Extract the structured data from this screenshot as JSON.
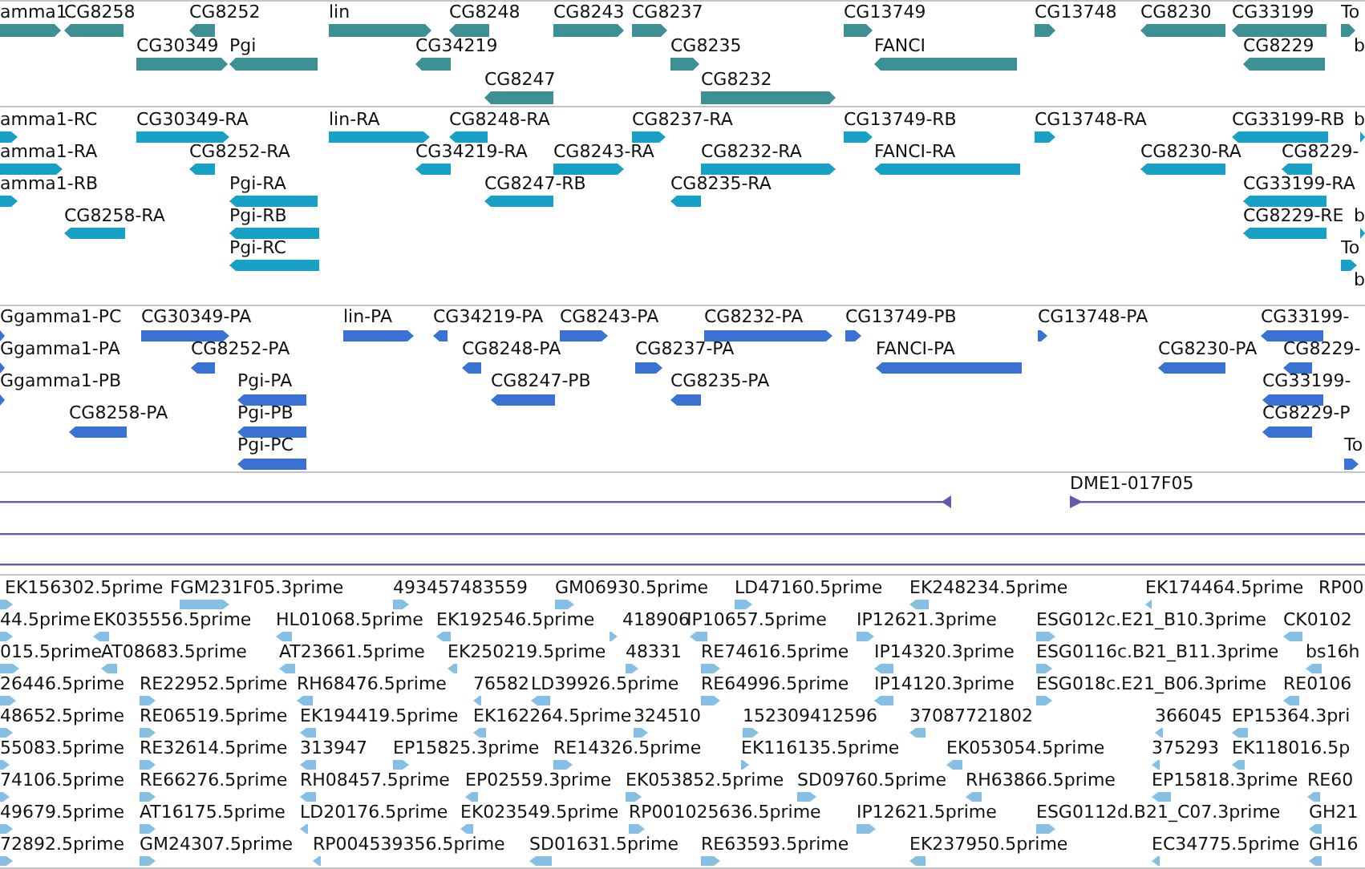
{
  "tracks": [
    {
      "kind": "gene",
      "rows": [
        {
          "features": [
            {
              "label": "amma1",
              "reverse": false
            },
            {
              "label": "CG8258",
              "reverse": true
            },
            {
              "label": "CG8252",
              "reverse": true
            },
            {
              "label": "lin",
              "reverse": false
            },
            {
              "label": "CG8248",
              "reverse": true
            },
            {
              "label": "CG8243",
              "reverse": false
            },
            {
              "label": "CG8237",
              "reverse": false
            },
            {
              "label": "CG13749",
              "reverse": false
            },
            {
              "label": "CG13748",
              "reverse": false
            },
            {
              "label": "CG8230",
              "reverse": true
            },
            {
              "label": "CG33199",
              "reverse": true
            },
            {
              "label": "To",
              "reverse": false
            }
          ]
        },
        {
          "features": [
            {
              "label": "CG30349",
              "reverse": false
            },
            {
              "label": "Pgi",
              "reverse": true
            },
            {
              "label": "CG34219",
              "reverse": true
            },
            {
              "label": "CG8235",
              "reverse": false
            },
            {
              "label": "FANCI",
              "reverse": true
            },
            {
              "label": "CG8229",
              "reverse": true
            },
            {
              "label": "b"
            }
          ]
        },
        {
          "features": [
            {
              "label": "CG8247",
              "reverse": true
            },
            {
              "label": "CG8232",
              "reverse": false
            }
          ]
        }
      ]
    },
    {
      "kind": "mrna",
      "rows": [
        {
          "features": [
            {
              "label": "amma1-RC",
              "reverse": false
            },
            {
              "label": "CG30349-RA",
              "reverse": false
            },
            {
              "label": "lin-RA",
              "reverse": false
            },
            {
              "label": "CG8248-RA",
              "reverse": true
            },
            {
              "label": "CG8237-RA",
              "reverse": false
            },
            {
              "label": "CG13749-RB",
              "reverse": false
            },
            {
              "label": "CG13748-RA",
              "reverse": false
            },
            {
              "label": "CG33199-RB",
              "reverse": true
            },
            {
              "label": "b",
              "reverse": false
            }
          ]
        },
        {
          "features": [
            {
              "label": "amma1-RA",
              "reverse": false
            },
            {
              "label": "CG8252-RA",
              "reverse": true
            },
            {
              "label": "CG34219-RA",
              "reverse": true
            },
            {
              "label": "CG8243-RA",
              "reverse": false
            },
            {
              "label": "CG8232-RA",
              "reverse": false
            },
            {
              "label": "FANCI-RA",
              "reverse": true
            },
            {
              "label": "CG8230-RA",
              "reverse": true
            },
            {
              "label": "CG8229-",
              "reverse": true
            }
          ]
        },
        {
          "features": [
            {
              "label": "amma1-RB",
              "reverse": false
            },
            {
              "label": "Pgi-RA",
              "reverse": true
            },
            {
              "label": "CG8247-RB",
              "reverse": true
            },
            {
              "label": "CG8235-RA",
              "reverse": true
            },
            {
              "label": "CG33199-RA",
              "reverse": true
            }
          ]
        },
        {
          "features": [
            {
              "label": "CG8258-RA",
              "reverse": true
            },
            {
              "label": "Pgi-RB",
              "reverse": true
            },
            {
              "label": "CG8229-RE",
              "reverse": true
            },
            {
              "label": "b",
              "reverse": false
            }
          ]
        },
        {
          "features": [
            {
              "label": "Pgi-RC",
              "reverse": true
            },
            {
              "label": "To",
              "reverse": false
            }
          ]
        },
        {
          "features": [
            {
              "label": "b"
            }
          ]
        }
      ]
    },
    {
      "kind": "cds",
      "rows": [
        {
          "features": [
            {
              "label": "Ggamma1-PC",
              "reverse": false
            },
            {
              "label": "CG30349-PA",
              "reverse": false
            },
            {
              "label": "lin-PA",
              "reverse": false
            },
            {
              "label": "CG34219-PA",
              "reverse": true
            },
            {
              "label": "CG8243-PA",
              "reverse": false
            },
            {
              "label": "CG8232-PA",
              "reverse": false
            },
            {
              "label": "CG13749-PB",
              "reverse": false
            },
            {
              "label": "CG13748-PA",
              "reverse": false
            },
            {
              "label": "CG33199-",
              "reverse": true
            }
          ]
        },
        {
          "features": [
            {
              "label": "Ggamma1-PA",
              "reverse": false
            },
            {
              "label": "CG8252-PA",
              "reverse": true
            },
            {
              "label": "CG8248-PA",
              "reverse": true
            },
            {
              "label": "CG8237-PA",
              "reverse": false
            },
            {
              "label": "FANCI-PA",
              "reverse": true
            },
            {
              "label": "CG8230-PA",
              "reverse": true
            },
            {
              "label": "CG8229-",
              "reverse": true
            }
          ]
        },
        {
          "features": [
            {
              "label": "Ggamma1-PB",
              "reverse": false
            },
            {
              "label": "Pgi-PA",
              "reverse": true
            },
            {
              "label": "CG8247-PB",
              "reverse": true
            },
            {
              "label": "CG8235-PA",
              "reverse": true
            },
            {
              "label": "CG33199-",
              "reverse": true
            }
          ]
        },
        {
          "features": [
            {
              "label": "CG8258-PA",
              "reverse": true
            },
            {
              "label": "Pgi-PB",
              "reverse": true
            },
            {
              "label": "CG8229-P",
              "reverse": true
            }
          ]
        },
        {
          "features": [
            {
              "label": "Pgi-PC",
              "reverse": true
            },
            {
              "label": "To",
              "reverse": false
            }
          ]
        }
      ]
    },
    {
      "kind": "clone",
      "rows": [
        {
          "features": [
            {
              "label": "DME1-017F05",
              "reverse": false
            }
          ]
        }
      ]
    },
    {
      "kind": "est",
      "rows": [
        {
          "features": [
            {
              "label": "EK156302.5prime",
              "reverse": false
            },
            {
              "label": "FGM231F05.3prime",
              "reverse": false
            },
            {
              "label": "493457483559",
              "reverse": false
            },
            {
              "label": "GM06930.5prime",
              "reverse": false
            },
            {
              "label": "LD47160.5prime",
              "reverse": false
            },
            {
              "label": "EK248234.5prime",
              "reverse": true
            },
            {
              "label": "EK174464.5prime",
              "reverse": true
            },
            {
              "label": "RP00"
            }
          ]
        },
        {
          "features": [
            {
              "label": "44.5prime",
              "reverse": false
            },
            {
              "label": "EK035556.5prime",
              "reverse": true
            },
            {
              "label": "HL01068.5prime",
              "reverse": true
            },
            {
              "label": "EK192546.5prime",
              "reverse": true
            },
            {
              "label": "418906",
              "reverse": false
            },
            {
              "label": "IP10657.5prime",
              "reverse": true
            },
            {
              "label": "IP12621.3prime",
              "reverse": false
            },
            {
              "label": "ESG012c.E21_B10.3prime",
              "reverse": false
            },
            {
              "label": "CK0102",
              "reverse": true
            }
          ]
        },
        {
          "features": [
            {
              "label": "015.5prime",
              "reverse": false
            },
            {
              "label": "AT08683.5prime",
              "reverse": true
            },
            {
              "label": "AT23661.5prime",
              "reverse": true
            },
            {
              "label": "EK250219.5prime",
              "reverse": true
            },
            {
              "label": "48331",
              "reverse": false
            },
            {
              "label": "RE74616.5prime",
              "reverse": false
            },
            {
              "label": "IP14320.3prime",
              "reverse": true
            },
            {
              "label": "ESG0116c.B21_B11.3prime",
              "reverse": false
            },
            {
              "label": "bs16h",
              "reverse": true
            }
          ]
        },
        {
          "features": [
            {
              "label": "26446.5prime",
              "reverse": false
            },
            {
              "label": "RE22952.5prime",
              "reverse": false
            },
            {
              "label": "RH68476.5prime",
              "reverse": true
            },
            {
              "label": "76582",
              "reverse": true
            },
            {
              "label": "LD39926.5prime",
              "reverse": true
            },
            {
              "label": "RE64996.5prime",
              "reverse": false
            },
            {
              "label": "IP14120.3prime",
              "reverse": true
            },
            {
              "label": "ESG018c.E21_B06.3prime",
              "reverse": false
            },
            {
              "label": "RE0106",
              "reverse": true
            }
          ]
        },
        {
          "features": [
            {
              "label": "48652.5prime",
              "reverse": false
            },
            {
              "label": "RE06519.5prime",
              "reverse": false
            },
            {
              "label": "EK194419.5prime",
              "reverse": true
            },
            {
              "label": "EK162264.5prime",
              "reverse": true
            },
            {
              "label": "324510",
              "reverse": false
            },
            {
              "label": "152309412596",
              "reverse": false
            },
            {
              "label": "37087721802",
              "reverse": true
            },
            {
              "label": "366045",
              "reverse": true
            },
            {
              "label": "EP15364.3pri",
              "reverse": true
            }
          ]
        },
        {
          "features": [
            {
              "label": "55083.5prime",
              "reverse": false
            },
            {
              "label": "RE32614.5prime",
              "reverse": false
            },
            {
              "label": "313947",
              "reverse": true
            },
            {
              "label": "EP15825.3prime",
              "reverse": false
            },
            {
              "label": "RE14326.5prime",
              "reverse": false
            },
            {
              "label": "EK116135.5prime",
              "reverse": false
            },
            {
              "label": "EK053054.5prime",
              "reverse": true
            },
            {
              "label": "375293",
              "reverse": true
            },
            {
              "label": "EK118016.5p",
              "reverse": true
            }
          ]
        },
        {
          "features": [
            {
              "label": "74106.5prime",
              "reverse": false
            },
            {
              "label": "RE66276.5prime",
              "reverse": false
            },
            {
              "label": "RH08457.5prime",
              "reverse": true
            },
            {
              "label": "EP02559.3prime",
              "reverse": true
            },
            {
              "label": "EK053852.5prime",
              "reverse": false
            },
            {
              "label": "SD09760.5prime",
              "reverse": false
            },
            {
              "label": "RH63866.5prime",
              "reverse": true
            },
            {
              "label": "EP15818.3prime",
              "reverse": true
            },
            {
              "label": "RE60",
              "reverse": true
            }
          ]
        },
        {
          "features": [
            {
              "label": "49679.5prime",
              "reverse": false
            },
            {
              "label": "AT16175.5prime",
              "reverse": false
            },
            {
              "label": "LD20176.5prime",
              "reverse": true
            },
            {
              "label": "EK023549.5prime",
              "reverse": true
            },
            {
              "label": "RP001025636.5prime",
              "reverse": false
            },
            {
              "label": "IP12621.5prime",
              "reverse": false
            },
            {
              "label": "ESG0112d.B21_C07.3prime",
              "reverse": false
            },
            {
              "label": "GH21",
              "reverse": true
            }
          ]
        },
        {
          "features": [
            {
              "label": "72892.5prime",
              "reverse": false
            },
            {
              "label": "GM24307.5prime",
              "reverse": false
            },
            {
              "label": "RP004539356.5prime",
              "reverse": true
            },
            {
              "label": "SD01631.5prime",
              "reverse": true
            },
            {
              "label": "RE63593.5prime",
              "reverse": false
            },
            {
              "label": "EK237950.5prime",
              "reverse": true
            },
            {
              "label": "EC34775.5prime",
              "reverse": true
            },
            {
              "label": "GH16",
              "reverse": true
            }
          ]
        }
      ]
    }
  ]
}
